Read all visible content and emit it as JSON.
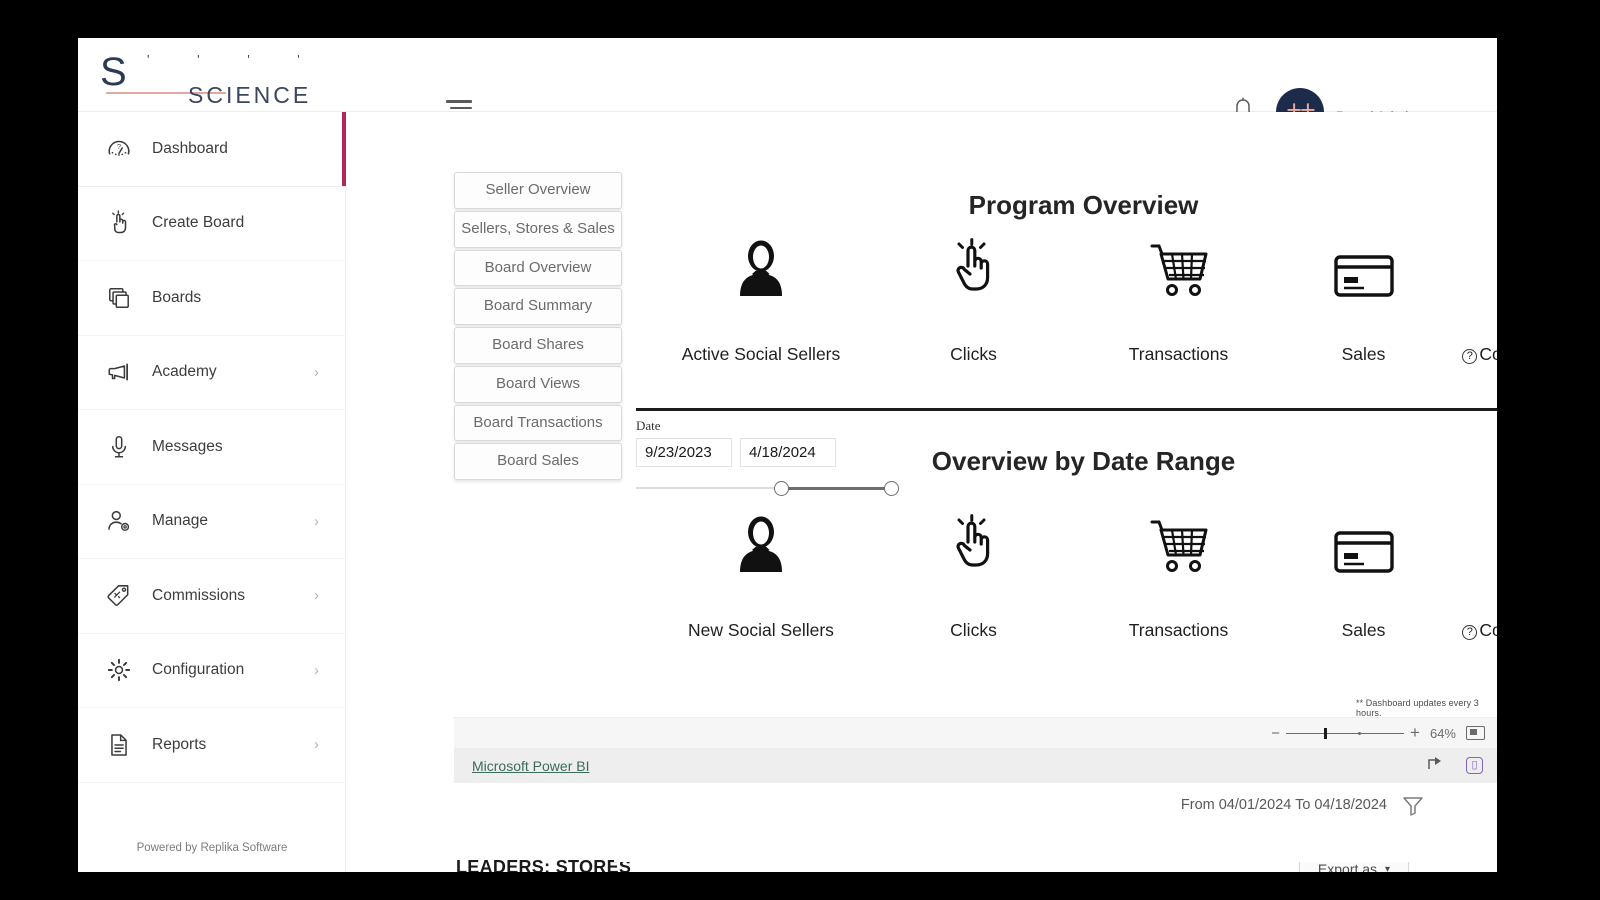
{
  "app": {
    "logo_letter": "S",
    "logo_word": "SCIENCE",
    "powered_by": "Powered by Replika Software"
  },
  "header": {
    "menu_icon": "hamburger-icon",
    "bell_icon": "notification-bell-icon",
    "avatar_initials": "++",
    "user_name": "",
    "user_role": "Brand Admin"
  },
  "sidebar": {
    "items": [
      {
        "label": "Dashboard",
        "icon": "gauge-icon",
        "caret": "",
        "active": true
      },
      {
        "label": "Create Board",
        "icon": "hand-click-icon",
        "caret": "",
        "active": false
      },
      {
        "label": "Boards",
        "icon": "cards-stack-icon",
        "caret": "",
        "active": false
      },
      {
        "label": "Academy",
        "icon": "megaphone-icon",
        "caret": "›",
        "active": false
      },
      {
        "label": "Messages",
        "icon": "microphone-icon",
        "caret": "",
        "active": false
      },
      {
        "label": "Manage",
        "icon": "user-gear-icon",
        "caret": "›",
        "active": false
      },
      {
        "label": "Commissions",
        "icon": "price-tag-icon",
        "caret": "›",
        "active": false
      },
      {
        "label": "Configuration",
        "icon": "gear-icon",
        "caret": "›",
        "active": false
      },
      {
        "label": "Reports",
        "icon": "document-icon",
        "caret": "›",
        "active": false
      }
    ]
  },
  "report": {
    "tabs": [
      {
        "label": "Seller Overview"
      },
      {
        "label": "Sellers, Stores & Sales"
      },
      {
        "label": "Board Overview"
      },
      {
        "label": "Board Summary"
      },
      {
        "label": "Board Shares"
      },
      {
        "label": "Board Views"
      },
      {
        "label": "Board Transactions"
      },
      {
        "label": "Board Sales"
      }
    ],
    "program_overview": {
      "title": "Program Overview",
      "metrics": [
        {
          "label": "Active Social Sellers",
          "value": "",
          "icon": "person-icon",
          "help": false
        },
        {
          "label": "Clicks",
          "value": "",
          "icon": "hand-click-icon",
          "help": false
        },
        {
          "label": "Transactions",
          "value": "",
          "icon": "shopping-cart-icon",
          "help": false
        },
        {
          "label": "Sales",
          "value": "",
          "icon": "credit-card-icon",
          "help": false
        },
        {
          "label": "Conversion Rate",
          "value": "",
          "icon": "dollar-refresh-icon",
          "help": true
        }
      ]
    },
    "date_slicer": {
      "title": "Date",
      "start_date": "9/23/2023",
      "end_date": "4/18/2024"
    },
    "date_range_overview": {
      "title": "Overview by Date Range",
      "metrics": [
        {
          "label": "New Social Sellers",
          "value": "",
          "icon": "person-icon",
          "help": false
        },
        {
          "label": "Clicks",
          "value": "",
          "icon": "hand-click-icon",
          "help": false
        },
        {
          "label": "Transactions",
          "value": "",
          "icon": "shopping-cart-icon",
          "help": false
        },
        {
          "label": "Sales",
          "value": "",
          "icon": "credit-card-icon",
          "help": false
        },
        {
          "label": "Conversion Rate",
          "value": "",
          "icon": "dollar-refresh-icon",
          "help": true
        }
      ],
      "footnote": "** Dashboard updates every 3 hours."
    },
    "powerbi": {
      "zoom_level": "64%",
      "fit_icon": "fit-to-page-icon",
      "brand_link": "Microsoft Power BI",
      "share_icon": "share-icon",
      "logo_icon": "power-bi-logo-icon"
    }
  },
  "bottom": {
    "date_range_label": "From 04/01/2024 To 04/18/2024",
    "filter_icon": "funnel-filter-icon",
    "leaders_title": "LEADERS: STORES",
    "export_label": "Export as",
    "export_caret": "▾"
  },
  "colors": {
    "accent": "#b4255b",
    "avatar_bg": "#1c2b4a",
    "avatar_fg": "#e8a99c",
    "link": "#3a6b5e",
    "powerbi_purple": "#8661c5"
  }
}
